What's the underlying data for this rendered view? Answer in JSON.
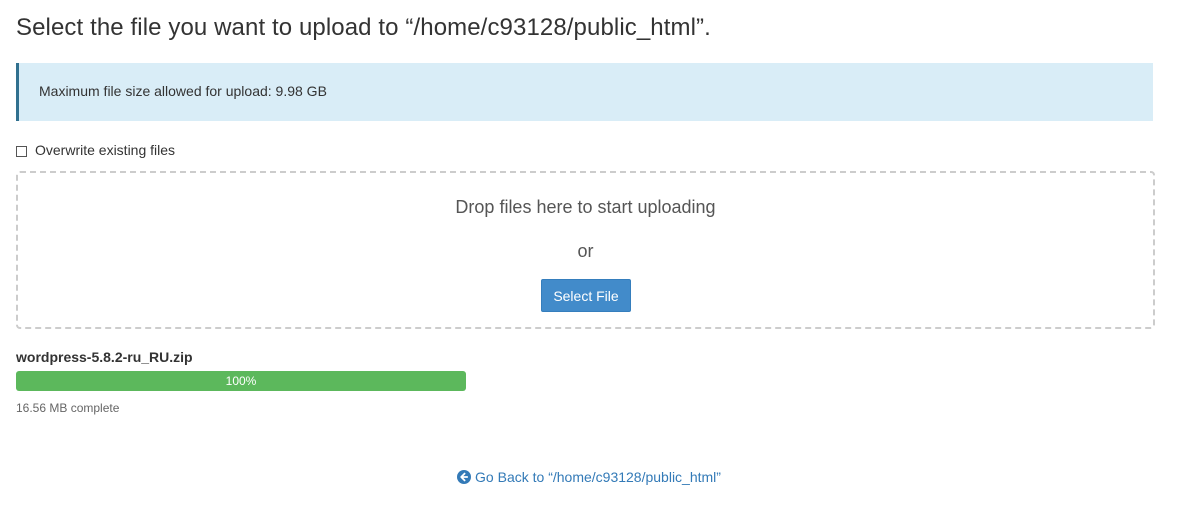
{
  "header": {
    "title": "Select the file you want to upload to “/home/c93128/public_html”."
  },
  "alert": {
    "message": "Maximum file size allowed for upload: 9.98 GB"
  },
  "overwrite": {
    "label": "Overwrite existing files",
    "checked": false
  },
  "dropzone": {
    "prompt": "Drop files here to start uploading",
    "or": "or",
    "select_button": "Select File"
  },
  "upload": {
    "file_name": "wordpress-5.8.2-ru_RU.zip",
    "progress_label": "100%",
    "progress": 1.0,
    "status": "16.56 MB complete"
  },
  "footer": {
    "back_icon": "arrow-circle-left-icon",
    "back_link": "Go Back to “/home/c93128/public_html”"
  },
  "colors": {
    "alert_bg": "#d9edf7",
    "button": "#428bca",
    "progress": "#5cb85c",
    "link": "#337ab7"
  }
}
